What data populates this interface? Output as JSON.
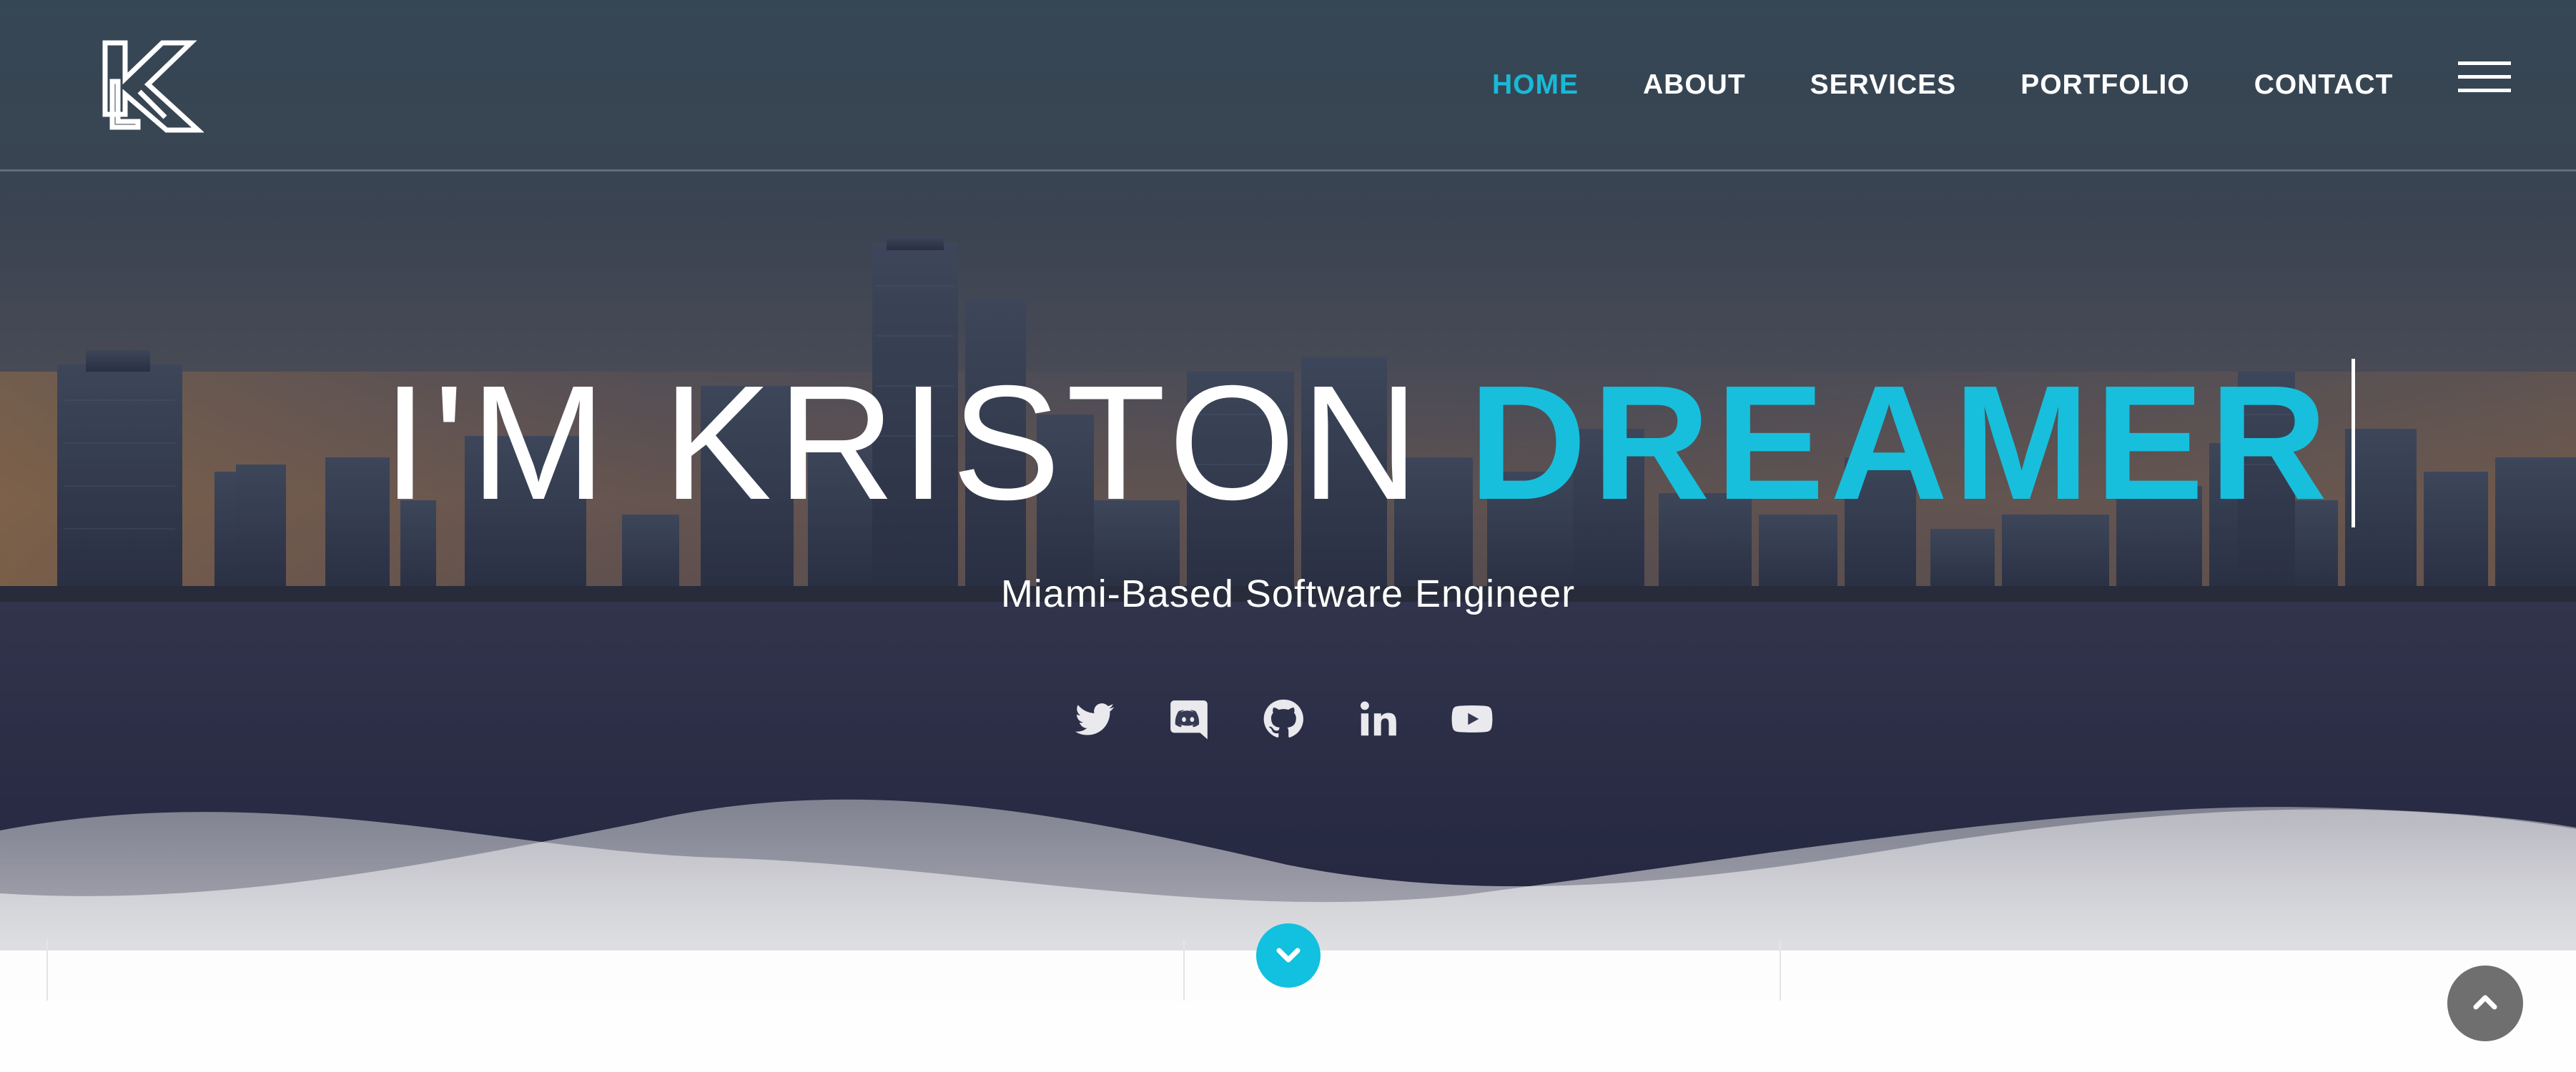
{
  "brand": {
    "logo_letter": "K"
  },
  "nav": {
    "items": [
      {
        "label": "HOME",
        "active": true
      },
      {
        "label": "ABOUT",
        "active": false
      },
      {
        "label": "SERVICES",
        "active": false
      },
      {
        "label": "PORTFOLIO",
        "active": false
      },
      {
        "label": "CONTACT",
        "active": false
      }
    ],
    "menu_icon": "hamburger-icon"
  },
  "hero": {
    "prefix": "I'M KRISTON",
    "highlight": "DREAMER",
    "subtitle": "Miami-Based Software Engineer"
  },
  "social": [
    {
      "icon": "twitter-icon"
    },
    {
      "icon": "discord-icon"
    },
    {
      "icon": "github-icon"
    },
    {
      "icon": "linkedin-icon"
    },
    {
      "icon": "youtube-icon"
    }
  ],
  "controls": {
    "scroll_down_icon": "chevron-down-icon",
    "back_to_top_icon": "chevron-up-icon"
  },
  "colors": {
    "accent": "#17bfdc",
    "nav_text": "#ffffff",
    "back_to_top_bg": "#6f6f6f",
    "sky_top": "#3f5561",
    "water": "#2a2b47"
  }
}
